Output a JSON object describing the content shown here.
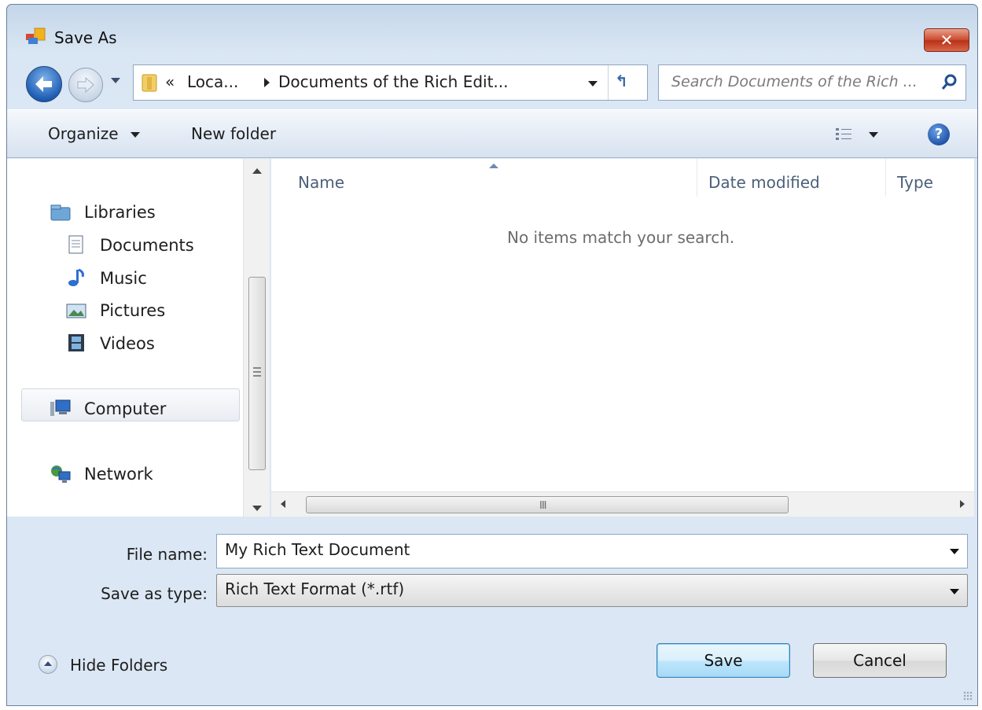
{
  "window": {
    "title": "Save As",
    "close_glyph": "✕"
  },
  "navigation": {
    "address_overflow_glyph": "«",
    "address_segments": [
      "Loca...",
      "Documents of the Rich Edit..."
    ],
    "refresh_glyph": "↰",
    "search_placeholder": "Search Documents of the Rich ..."
  },
  "toolbar": {
    "organize_label": "Organize",
    "new_folder_label": "New folder",
    "help_glyph": "?"
  },
  "nav_pane": {
    "items": [
      {
        "label": "Libraries",
        "icon": "libraries-icon"
      },
      {
        "label": "Documents",
        "icon": "documents-icon"
      },
      {
        "label": "Music",
        "icon": "music-icon"
      },
      {
        "label": "Pictures",
        "icon": "pictures-icon"
      },
      {
        "label": "Videos",
        "icon": "videos-icon"
      },
      {
        "label": "Computer",
        "icon": "computer-icon",
        "selected": true
      },
      {
        "label": "Network",
        "icon": "network-icon"
      }
    ]
  },
  "file_list": {
    "columns": [
      "Name",
      "Date modified",
      "Type"
    ],
    "sorted_column": "Name",
    "empty_message": "No items match your search.",
    "hscroll_grip": "III"
  },
  "form": {
    "file_name_label": "File name:",
    "file_name_value": "My Rich Text Document",
    "save_type_label": "Save as type:",
    "save_type_value": "Rich Text Format (*.rtf)"
  },
  "footer": {
    "hide_folders_label": "Hide Folders",
    "save_label": "Save",
    "cancel_label": "Cancel"
  },
  "colors": {
    "frame": "#c4d6ea",
    "default_button": "#bee6fd",
    "close_button": "#c9492c",
    "empty_text": "#6d6d6d"
  }
}
